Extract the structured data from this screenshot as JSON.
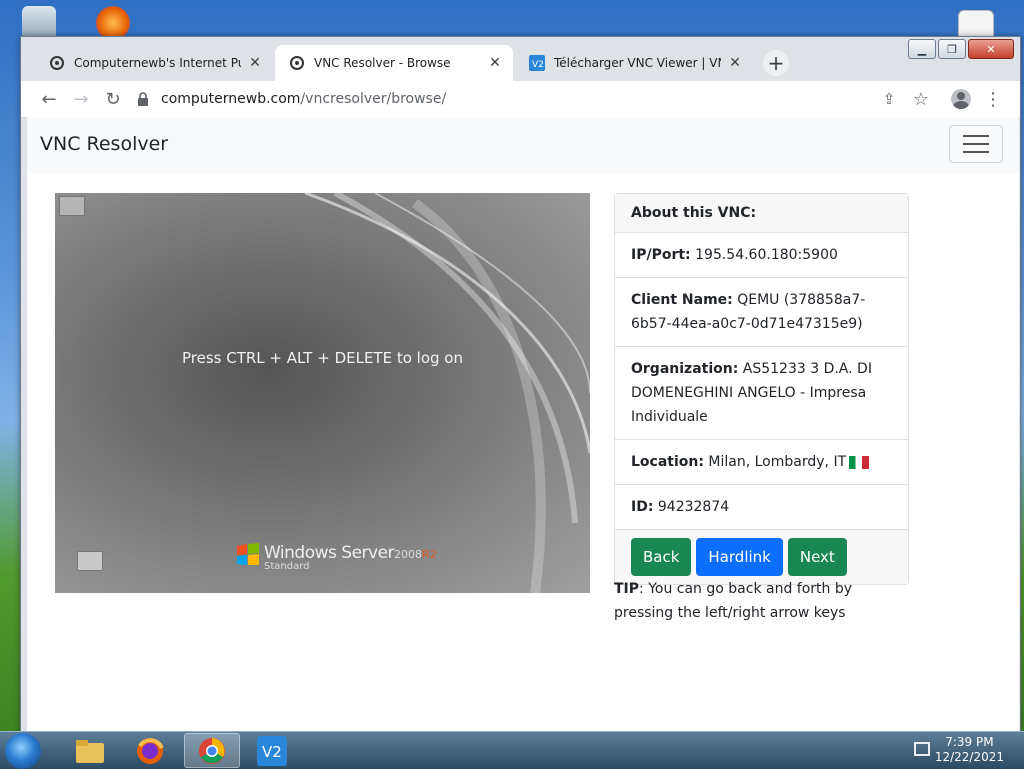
{
  "tabs": [
    {
      "title": "Computernewb's Internet Pub H",
      "active": false
    },
    {
      "title": "VNC Resolver - Browse",
      "active": true
    },
    {
      "title": "Télécharger VNC Viewer | VNC C",
      "active": false
    }
  ],
  "address": {
    "host": "computernewb.com",
    "path": "/vncresolver/browse/"
  },
  "page": {
    "brand": "VNC Resolver",
    "screen": {
      "message": "Press CTRL + ALT + DELETE to log on",
      "logo_brand": "Windows Server",
      "logo_version": "2008",
      "logo_release": "R2",
      "logo_edition": "Standard"
    },
    "card": {
      "header": "About this VNC:",
      "ip_label": "IP/Port:",
      "ip": "195.54.60.180:5900",
      "client_label": "Client Name:",
      "client": "QEMU (378858a7-6b57-44ea-a0c7-0d71e47315e9)",
      "org_label": "Organization:",
      "org": "AS51233 3 D.A. DI DOMENEGHINI ANGELO - Impresa Individuale",
      "location_label": "Location:",
      "location": "Milan, Lombardy, IT",
      "id_label": "ID:",
      "id": "94232874",
      "buttons": {
        "back": "Back",
        "hardlink": "Hardlink",
        "next": "Next"
      }
    },
    "tip_label": "TIP",
    "tip": ": You can go back and forth by pressing the left/right arrow keys"
  },
  "taskbar": {
    "time": "7:39 PM",
    "date": "12/22/2021"
  },
  "colors": {
    "success": "#198754",
    "primary": "#0d6efd"
  }
}
